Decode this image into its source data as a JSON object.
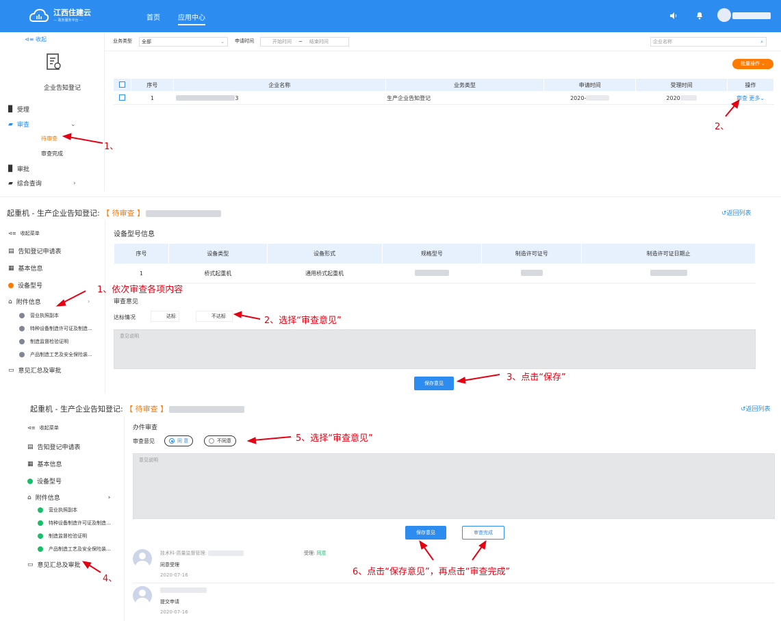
{
  "topbar": {
    "logo_title": "江西住建云",
    "logo_sub": "— 政务服务平台 —",
    "nav": [
      "首页",
      "应用中心"
    ]
  },
  "panel1": {
    "collapse": "收起",
    "module_title": "企业告知登记",
    "menu": {
      "accept": "受理",
      "review": "审查",
      "review_pending": "待审查",
      "review_done": "审查完成",
      "approve": "审批",
      "query": "综合查询"
    },
    "filter": {
      "biz_type_label": "业务类型",
      "biz_type_value": "全部",
      "apply_time_label": "申请时间",
      "start_ph": "开始时间",
      "tilde": "~",
      "end_ph": "结束时间",
      "company_ph": "企业名称"
    },
    "batch_btn": "批量操作",
    "table": {
      "headers": [
        "序号",
        "企业名称",
        "业务类型",
        "申请时间",
        "受理时间",
        "操作"
      ],
      "row": {
        "no": "1",
        "company_tail": "3",
        "type": "生产企业告知登记",
        "apply": "2020-",
        "accept": "2020",
        "action_review": "审查",
        "action_more": "更多"
      }
    },
    "anno1": "1、",
    "anno2": "2、"
  },
  "panel2": {
    "title_prefix": "起重机 - 生产企业告知登记:",
    "status": "【 待审查 】",
    "return": "返回列表",
    "collapse_menu": "收起菜单",
    "menu": [
      "告知登记申请表",
      "基本信息",
      "设备型号",
      "附件信息",
      "意见汇总及审批"
    ],
    "attachments": [
      "营业执照副本",
      "特种设备制造许可证及制造...",
      "制造监督检验证明",
      "产品制造工艺及安全保险装..."
    ],
    "section_title": "设备型号信息",
    "table": {
      "headers": [
        "序号",
        "设备类型",
        "设备形式",
        "规格型号",
        "制造许可证号",
        "制造许可证日期止"
      ],
      "row": {
        "no": "1",
        "type": "桥式起重机",
        "form": "通用桥式起重机"
      }
    },
    "review_title": "审查意见",
    "standard_label": "达标情况",
    "opt_pass": "达标",
    "opt_fail": "不达标",
    "opinion_ph": "意见说明",
    "save_btn": "保存意见",
    "anno1": "1、依次审查各项内容",
    "anno2": "2、选择“审查意见”",
    "anno3": "3、点击“保存”"
  },
  "panel3": {
    "title_prefix": "起重机 - 生产企业告知登记:",
    "status": "【 待审查 】",
    "return": "返回列表",
    "collapse_menu": "收起菜单",
    "menu": [
      "告知登记申请表",
      "基本信息",
      "设备型号",
      "附件信息",
      "意见汇总及审批"
    ],
    "attachments": [
      "营业执照副本",
      "特种设备制造许可证及制造...",
      "制造监督检验证明",
      "产品制造工艺及安全保险装..."
    ],
    "section_title": "办件审查",
    "opinion_label": "审查意见",
    "agree": "同 意",
    "disagree": "不同意",
    "opinion_ph": "意见说明",
    "save_btn": "保存意见",
    "done_btn": "审查完成",
    "records": [
      {
        "who": "技术科-质量监督管理:",
        "note": "同意受理",
        "date": "2020-07-16",
        "status_label": "受理:",
        "status_value": "同意"
      },
      {
        "who": "",
        "note": "提交申请",
        "date": "2020-07-16"
      }
    ],
    "anno4": "4、",
    "anno5": "5、选择“审查意见”",
    "anno6": "6、点击“保存意见”，再点击“审查完成”"
  }
}
